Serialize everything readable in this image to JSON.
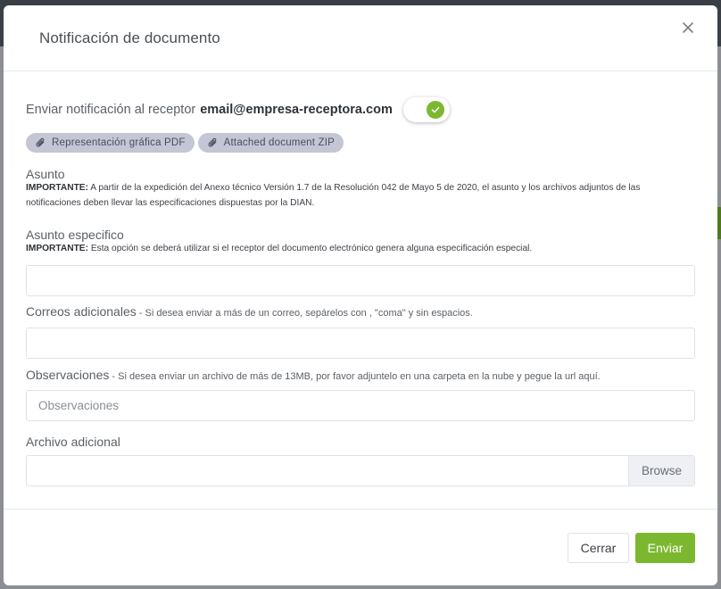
{
  "modal": {
    "title": "Notificación de documento"
  },
  "notify": {
    "label": "Enviar notificación al receptor",
    "email": "email@empresa-receptora.com",
    "toggle_on": true
  },
  "attachments": [
    {
      "label": "Representación gráfica PDF",
      "icon": "paperclip-icon"
    },
    {
      "label": "Attached document ZIP",
      "icon": "paperclip-icon"
    }
  ],
  "asunto": {
    "label": "Asunto",
    "note_strong": "IMPORTANTE:",
    "note_text": " A partir de la expedición del Anexo técnico Versión 1.7 de la Resolución 042 de Mayo 5 de 2020, el asunto y los archivos adjuntos de las notificaciones deben llevar las especificaciones dispuestas por la DIAN."
  },
  "asunto_especifico": {
    "label": "Asunto especifico",
    "note_strong": "IMPORTANTE:",
    "note_text": " Esta opción se deberá utilizar si el receptor del documento electrónico genera alguna especificación especial.",
    "value": ""
  },
  "correos": {
    "label": "Correos adicionales",
    "hint": " - Si desea enviar a más de un correo, sepárelos con , \"coma\" y sin espacios.",
    "value": ""
  },
  "observaciones": {
    "label": "Observaciones",
    "hint": " - Si desea enviar un archivo de más de 13MB, por favor adjuntelo en una carpeta en la nube y pegue la url aquí.",
    "placeholder": "Observaciones",
    "value": ""
  },
  "archivo": {
    "label": "Archivo adicional",
    "browse_label": "Browse"
  },
  "footer": {
    "cancel_label": "Cerrar",
    "submit_label": "Enviar"
  },
  "colors": {
    "accent": "#7cb82f",
    "chip_bg": "#c4c6d6"
  }
}
